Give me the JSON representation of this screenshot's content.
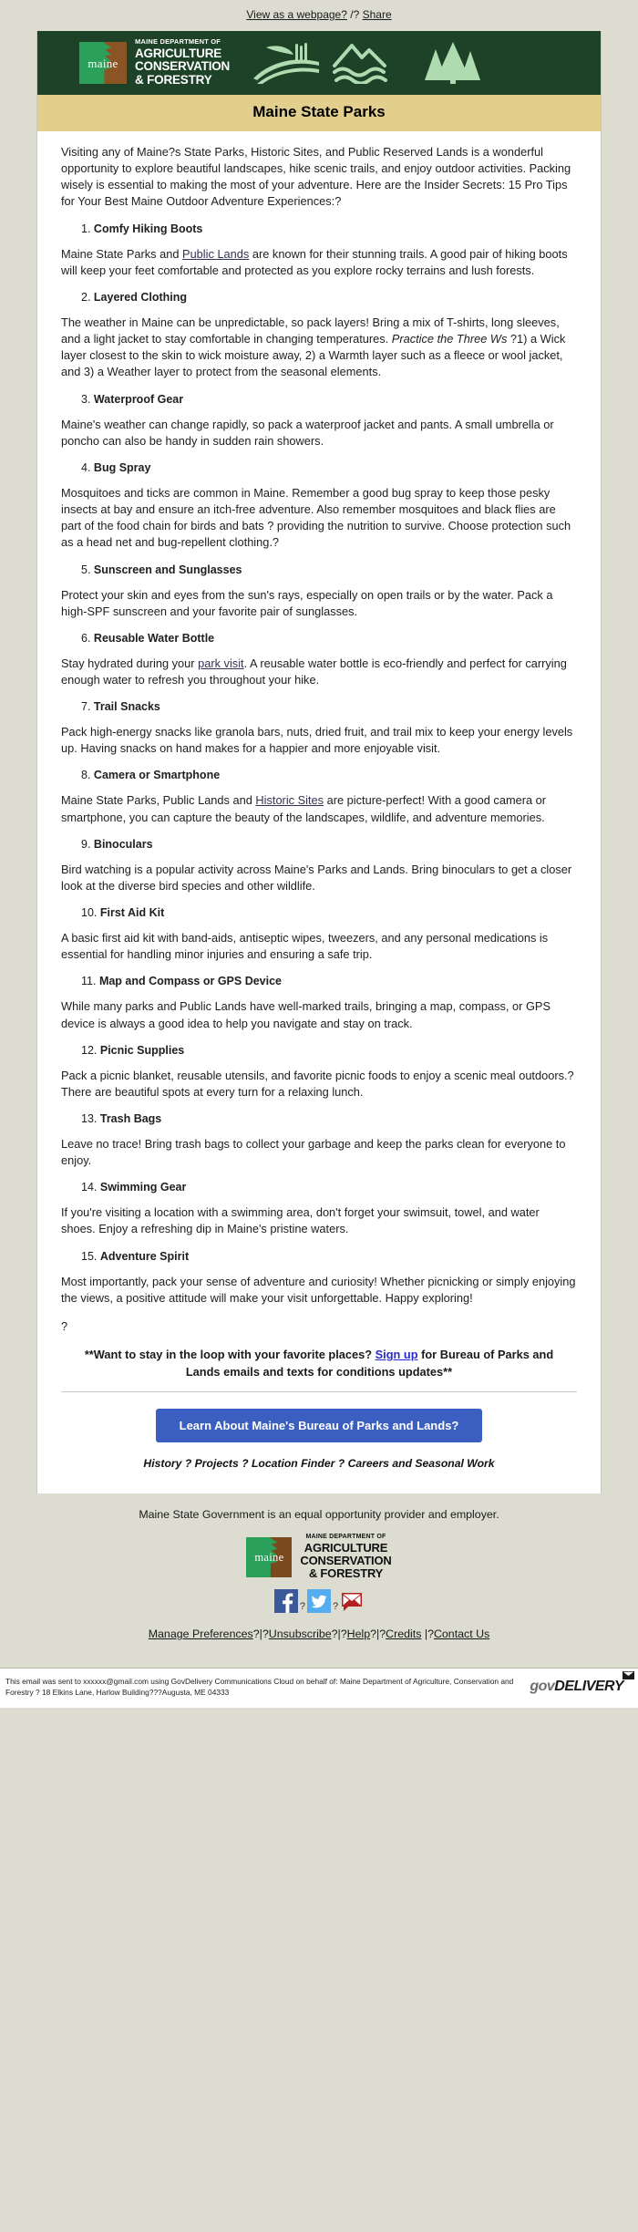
{
  "preheader": {
    "view_webpage": "View as a webpage?",
    "separator": " /? ",
    "share": "Share"
  },
  "banner": {
    "logo_word": "maine",
    "dept_small": "MAINE DEPARTMENT OF",
    "dept_line1": "AGRICULTURE",
    "dept_line2": "CONSERVATION",
    "dept_line3": "& FORESTRY",
    "art_icons": [
      "farm-field-icon",
      "mountain-water-icon",
      "pine-trees-icon"
    ],
    "bg_color": "#1d4228"
  },
  "title_bar": {
    "title": "Maine State Parks",
    "bg_color": "#e3cf8d"
  },
  "intro": "Visiting any of Maine?s State Parks, Historic Sites, and Public Reserved Lands is a wonderful opportunity to explore beautiful landscapes, hike scenic trails, and enjoy outdoor activities. Packing wisely is essential to making the most of your adventure. Here are the Insider Secrets: 15 Pro Tips for Your Best Maine Outdoor Adventure Experiences:?",
  "tips": [
    {
      "number": "1.",
      "title": "Comfy Hiking Boots",
      "body_pre": "Maine State Parks and ",
      "link": "Public Lands",
      "body_post": " are known for their stunning trails. A good pair of hiking boots will keep your feet comfortable and protected as you explore rocky terrains and lush forests."
    },
    {
      "number": "2.",
      "title": "Layered Clothing",
      "body_pre": "The weather in Maine can be unpredictable, so pack layers! Bring a mix of T-shirts, long sleeves, and a light jacket to stay comfortable in changing temperatures. ",
      "italic": "Practice the Three Ws",
      "body_post": " ?1) a Wick layer closest to the skin to wick moisture away, 2) a Warmth layer such as a fleece or wool jacket, and 3) a Weather layer to protect from the seasonal elements."
    },
    {
      "number": "3.",
      "title": "Waterproof Gear",
      "body_pre": "Maine's weather can change rapidly, so pack a waterproof jacket and pants. A small umbrella or poncho can also be handy in sudden rain showers."
    },
    {
      "number": "4.",
      "title": "Bug Spray",
      "body_pre": "Mosquitoes and ticks are common in Maine. Remember a good bug spray to keep those pesky insects at bay and ensure an itch-free adventure. Also remember mosquitoes and black flies are part of the food chain for birds and bats ? providing the nutrition to survive. Choose protection such as a head net and bug-repellent clothing.?"
    },
    {
      "number": "5.",
      "title": "Sunscreen and Sunglasses",
      "body_pre": "Protect your skin and eyes from the sun's rays, especially on open trails or by the water. Pack a high-SPF sunscreen and your favorite pair of sunglasses."
    },
    {
      "number": "6.",
      "title": "Reusable Water Bottle",
      "body_pre": "Stay hydrated during your ",
      "link": "park visit",
      "body_post": ". A reusable water bottle is eco-friendly and perfect for carrying enough water to refresh you throughout your hike."
    },
    {
      "number": "7.",
      "title": "Trail Snacks",
      "body_pre": "Pack high-energy snacks like granola bars, nuts, dried fruit, and trail mix to keep your energy levels up. Having snacks on hand makes for a happier and more enjoyable visit."
    },
    {
      "number": "8.",
      "title": "Camera or Smartphone",
      "body_pre": "Maine State Parks, Public Lands and ",
      "link": "Historic Sites",
      "body_post": " are picture-perfect! With a good camera or smartphone, you can capture the beauty of the landscapes, wildlife, and adventure memories."
    },
    {
      "number": "9.",
      "title": "Binoculars",
      "body_pre": "Bird watching is a popular activity across Maine's Parks and Lands. Bring binoculars to get a closer look at the diverse bird species and other wildlife."
    },
    {
      "number": "10.",
      "title": "First Aid Kit",
      "body_pre": "A basic first aid kit with band-aids, antiseptic wipes, tweezers, and any personal medications is essential for handling minor injuries and ensuring a safe trip."
    },
    {
      "number": "11.",
      "title": "Map and Compass or GPS Device",
      "body_pre": "While many parks and Public Lands have well-marked trails, bringing a map, compass, or GPS device is always a good idea to help you navigate and stay on track."
    },
    {
      "number": "12.",
      "title": "Picnic Supplies",
      "body_pre": "Pack a picnic blanket, reusable utensils, and favorite picnic foods to enjoy a scenic meal outdoors.?There are beautiful spots at every turn for a relaxing lunch."
    },
    {
      "number": "13.",
      "title": "Trash Bags",
      "body_pre": "Leave no trace! Bring trash bags to collect your garbage and keep the parks clean for everyone to enjoy."
    },
    {
      "number": "14.",
      "title": "Swimming Gear",
      "body_pre": "If you're visiting a location with a swimming area, don't forget your swimsuit, towel, and water shoes. Enjoy a refreshing dip in Maine's pristine waters."
    },
    {
      "number": "15.",
      "title": "Adventure Spirit",
      "body_pre": "Most importantly, pack your sense of adventure and curiosity! Whether picnicking or simply enjoying the views, a positive attitude will make your visit unforgettable. Happy exploring!"
    }
  ],
  "after_tips_qmark": "?",
  "promo": {
    "pre": "**Want to stay in the loop with your favorite places? ",
    "link": "Sign up",
    "post": " for Bureau of Parks and Lands emails and texts for conditions updates**"
  },
  "cta": {
    "label": "Learn About Maine's Bureau of Parks and Lands?",
    "bg_color": "#3b5fc0"
  },
  "sublinks": "History ? Projects ? Location Finder ? Careers and Seasonal Work",
  "footer": {
    "eeo": "Maine State Government is an equal opportunity provider and employer.",
    "logo_word": "maine",
    "dept_small": "MAINE DEPARTMENT OF",
    "dept_line1": "AGRICULTURE",
    "dept_line2": "CONSERVATION",
    "dept_line3": "& FORESTRY",
    "social": [
      {
        "name": "facebook-icon",
        "color": "#3b5998"
      },
      {
        "name": "twitter-icon",
        "color": "#55acee"
      },
      {
        "name": "email-icon",
        "color": "#b32020"
      }
    ],
    "social_separator": "?",
    "links": [
      {
        "label": "Manage Preferences",
        "sep": "?|?"
      },
      {
        "label": "Unsubscribe",
        "sep": "?|?"
      },
      {
        "label": "Help",
        "sep": "?|?"
      },
      {
        "label": "Credits",
        "sep": " |?"
      },
      {
        "label": "Contact Us",
        "sep": ""
      }
    ]
  },
  "govdelivery": {
    "disclaimer": "This email was sent to xxxxxx@gmail.com using GovDelivery Communications Cloud on behalf of: Maine Department of Agriculture, Conservation and Forestry ? 18 Elkins Lane, Harlow Building???Augusta, ME 04333",
    "logo_gov": "gov",
    "logo_delivery": "DELIVERY"
  }
}
